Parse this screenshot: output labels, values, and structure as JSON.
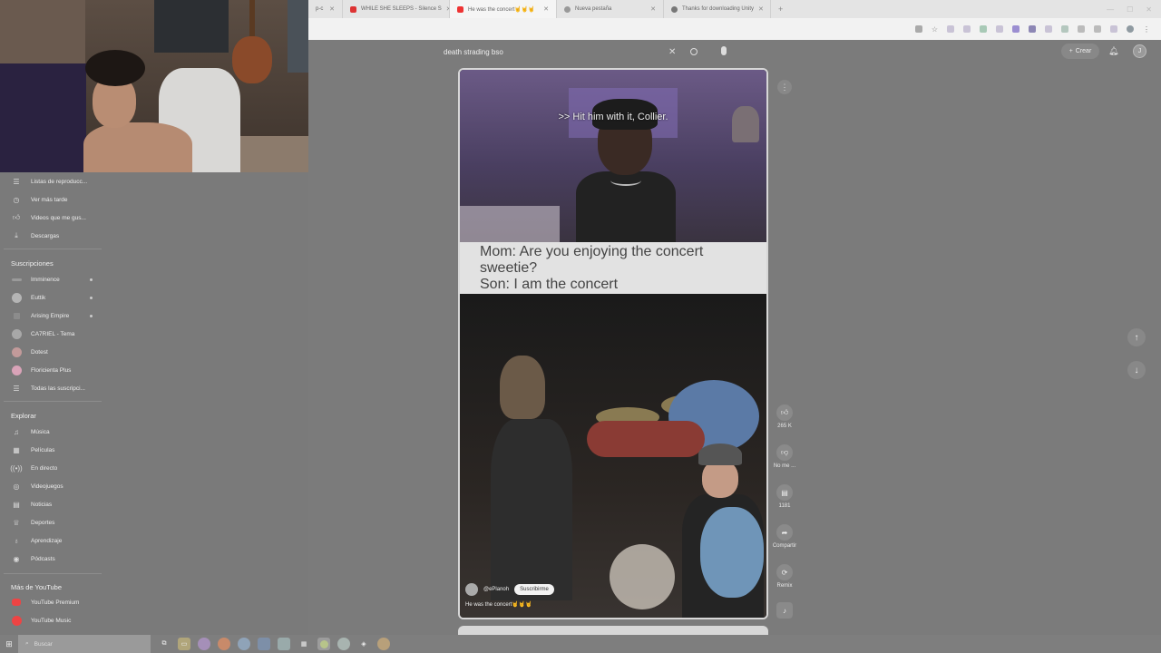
{
  "browser": {
    "tabs": [
      {
        "label": "p-c",
        "favicon_color": "#c25"
      },
      {
        "label": "WHILE SHE SLEEPS - Silence S",
        "favicon_color": "#d33"
      },
      {
        "label": "He was the concert🤘🤘🤘",
        "favicon_color": "#e33"
      },
      {
        "label": "Nueva pestaña",
        "favicon_color": "#999"
      },
      {
        "label": "Thanks for downloading Unity",
        "favicon_color": "#777"
      }
    ],
    "new_tab": "+"
  },
  "youtube": {
    "search_value": "death strading bso",
    "create_label": "Crear",
    "user_initial": "J",
    "short": {
      "subtitle": ">> Hit him with it, Collier.",
      "meme_lines": [
        "Mom: Are you enjoying the concert",
        "sweetie?",
        "Son: I am the concert"
      ],
      "channel": "@ePlanoh",
      "subscribe": "Suscribirme",
      "title": "He was the concert🤘🤘🤘"
    },
    "actions": {
      "likes": "265 K",
      "dislike": "No me ...",
      "comments": "1181",
      "share": "Compartir",
      "remix": "Remix"
    }
  },
  "sidebar": {
    "top_items": [
      {
        "label": "Listas de reproducc...",
        "icon": "playlist-icon"
      },
      {
        "label": "Ver más tarde",
        "icon": "clock-icon"
      },
      {
        "label": "Videos que me gus...",
        "icon": "thumb-up-icon"
      },
      {
        "label": "Descargas",
        "icon": "download-icon"
      }
    ],
    "subscriptions_heading": "Suscripciones",
    "subscriptions": [
      {
        "label": "Imminence",
        "color": "#9a9a9a",
        "live": true
      },
      {
        "label": "Euttik",
        "color": "#b5b5b5",
        "live": true
      },
      {
        "label": "Arising Empire",
        "color": "#8c8c8c",
        "live": true
      },
      {
        "label": "CA7RIEL - Tema",
        "color": "#a8a8a8",
        "live": false
      },
      {
        "label": "Dotest",
        "color": "#c29a9a",
        "live": false
      },
      {
        "label": "Floricienta Plus",
        "color": "#d9a3b8",
        "live": false
      },
      {
        "label": "Todas las suscripci...",
        "color": "",
        "live": false
      }
    ],
    "explore_heading": "Explorar",
    "explore": [
      {
        "label": "Música",
        "icon": "music-icon"
      },
      {
        "label": "Películas",
        "icon": "film-icon"
      },
      {
        "label": "En directo",
        "icon": "live-icon"
      },
      {
        "label": "Videojuegos",
        "icon": "gamepad-icon"
      },
      {
        "label": "Noticias",
        "icon": "news-icon"
      },
      {
        "label": "Deportes",
        "icon": "trophy-icon"
      },
      {
        "label": "Aprendizaje",
        "icon": "bulb-icon"
      },
      {
        "label": "Pódcasts",
        "icon": "podcast-icon"
      }
    ],
    "more_heading": "Más de YouTube",
    "more": [
      {
        "label": "YouTube Premium",
        "color": "#e44"
      },
      {
        "label": "YouTube Music",
        "color": "#e44"
      }
    ]
  },
  "taskbar": {
    "search_placeholder": "Buscar"
  }
}
